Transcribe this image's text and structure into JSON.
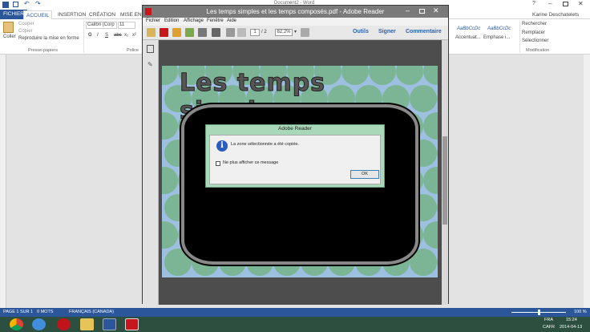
{
  "word": {
    "title": "Document2 - Word",
    "user": "Karine Deschatelets",
    "tabs": [
      "FICHIER",
      "ACCUEIL",
      "INSERTION",
      "CRÉATION",
      "MISE EN PA"
    ],
    "clipboard": {
      "paste": "Coller",
      "cut": "Couper",
      "copy": "Copier",
      "format_painter": "Reproduire la mise en forme",
      "group": "Presse-papiers"
    },
    "font": {
      "name": "Calibri (Corp",
      "size": "11",
      "bold": "G",
      "italic": "I",
      "underline": "S",
      "strike": "abc",
      "sub": "x₂",
      "sup": "x²",
      "group": "Police"
    },
    "styles": {
      "s1": "AaBbCcDc",
      "s2": "AaBbCcDc",
      "label1": "Accentuat...",
      "label2": "Emphase i..."
    },
    "editing": {
      "find": "Rechercher",
      "replace": "Remplacer",
      "select": "Sélectionner",
      "group": "Modification"
    }
  },
  "status": {
    "page": "PAGE 1 SUR 1",
    "words": "0 MOTS",
    "lang": "FRANÇAIS (CANADA)",
    "zoom": "100 %"
  },
  "taskbar": {
    "lang": "FRA",
    "region": "CAFR",
    "time": "15:24",
    "date": "2014-04-13"
  },
  "reader": {
    "title": "Les temps simples et les temps composés.pdf - Adobe Reader",
    "menu": [
      "Fichier",
      "Edition",
      "Affichage",
      "Fenêtre",
      "Aide"
    ],
    "page_current": "1",
    "page_total": "/ 2",
    "zoom": "62,2%",
    "tools": [
      "Outils",
      "Signer",
      "Commentaire"
    ],
    "pdf_heading": "Les temps simples"
  },
  "dialog": {
    "title": "Adobe Reader",
    "message": "La zone sélectionnée a été copiée.",
    "checkbox": "Ne plus afficher ce message",
    "ok": "OK"
  },
  "colors": {
    "word_blue": "#2b579a",
    "dialog_green": "#a9d8b8",
    "page_blue": "#9ec0e0",
    "blob_green": "#7bb596"
  }
}
